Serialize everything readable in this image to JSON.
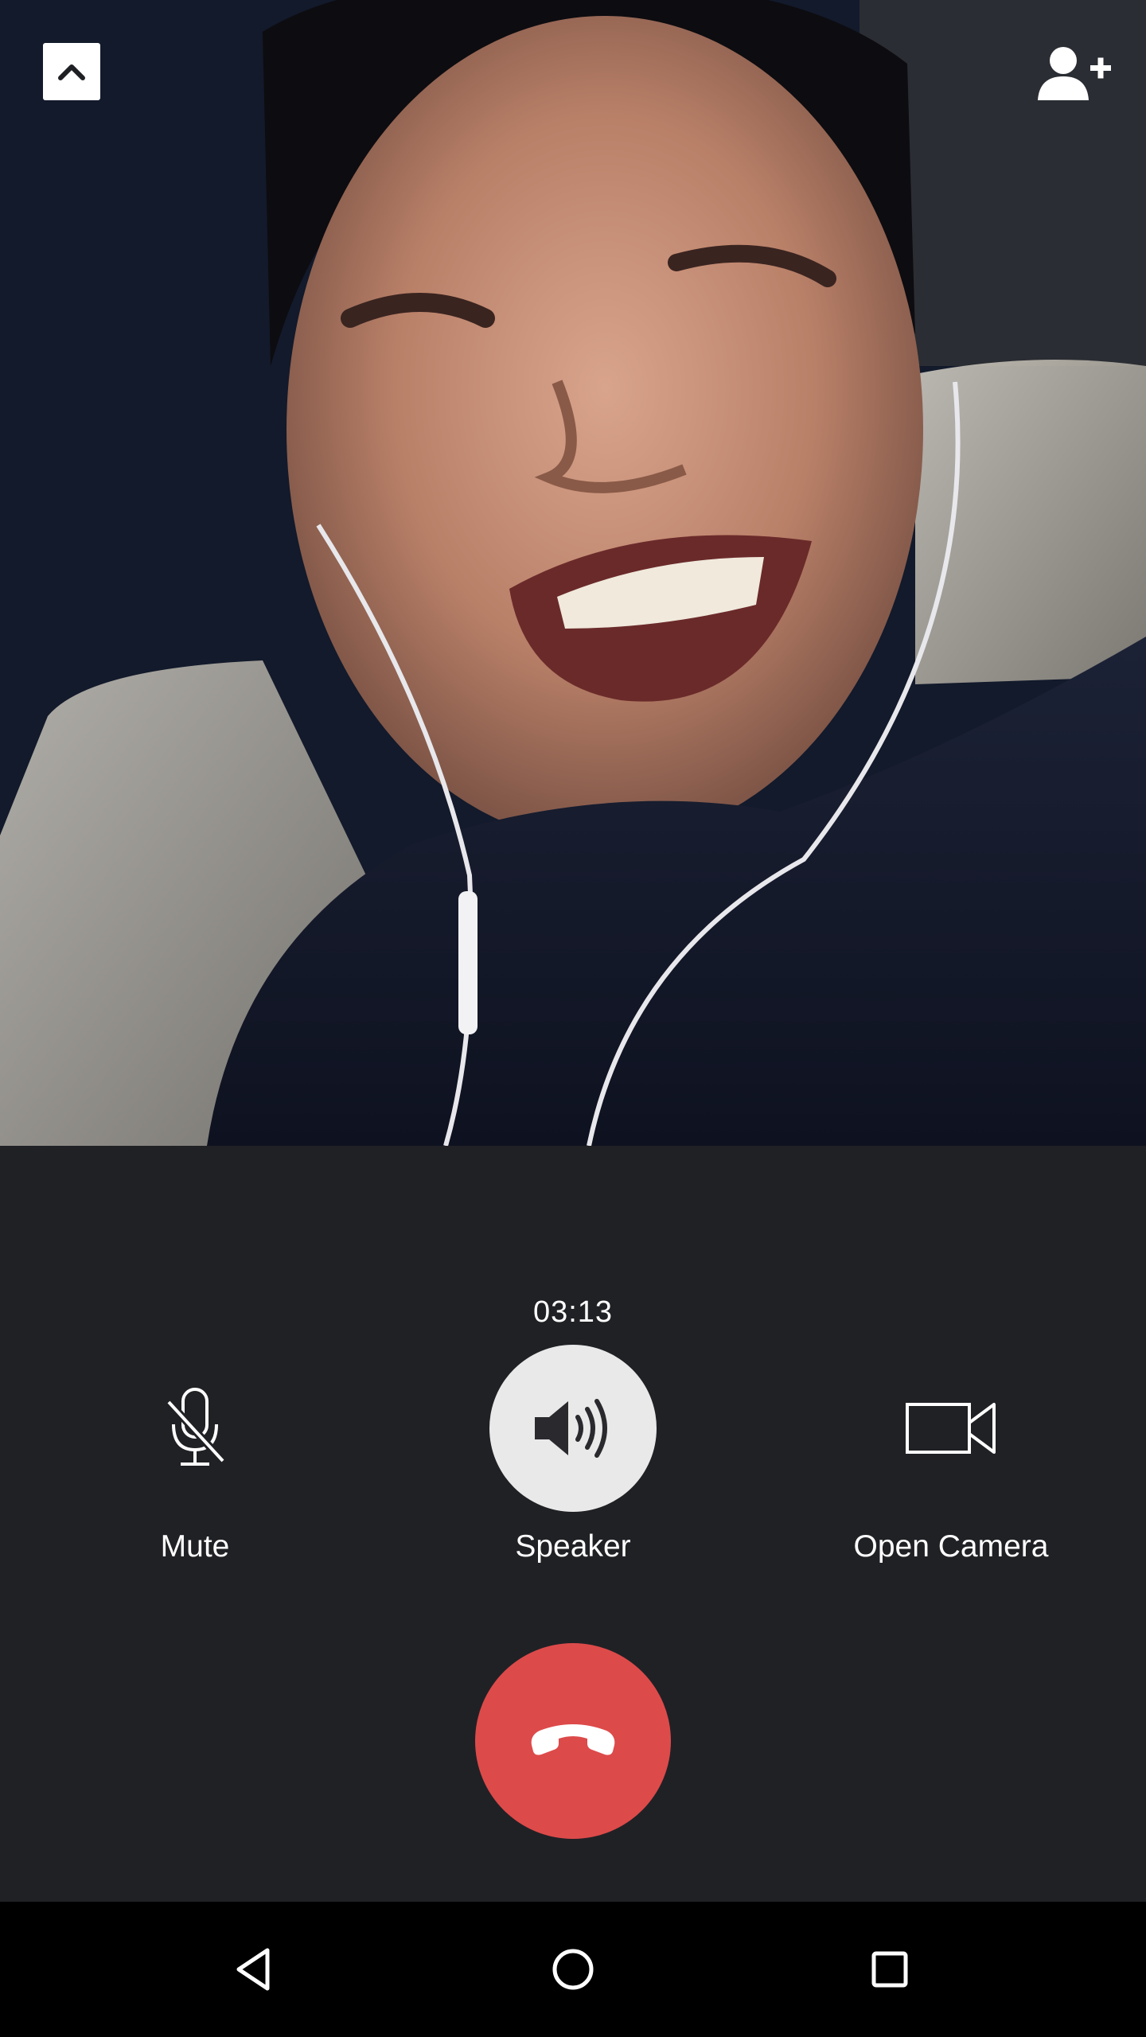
{
  "call": {
    "duration": "03:13",
    "remote_video_description": "remote participant camera feed"
  },
  "controls": {
    "mute_label": "Mute",
    "speaker_label": "Speaker",
    "camera_label": "Open Camera",
    "speaker_active": true
  },
  "icons": {
    "collapse": "chevron-up-icon",
    "add_person": "add-person-icon",
    "mute": "mic-off-icon",
    "speaker": "speaker-volume-icon",
    "camera": "video-camera-icon",
    "hangup": "phone-hangup-icon",
    "nav_back": "back-triangle-icon",
    "nav_home": "home-circle-icon",
    "nav_recent": "recent-square-icon"
  },
  "colors": {
    "panel_background": "#202125",
    "hangup": "#dd4a4a",
    "speaker_active_bg": "#e9e9e9",
    "navbar": "#000000"
  }
}
